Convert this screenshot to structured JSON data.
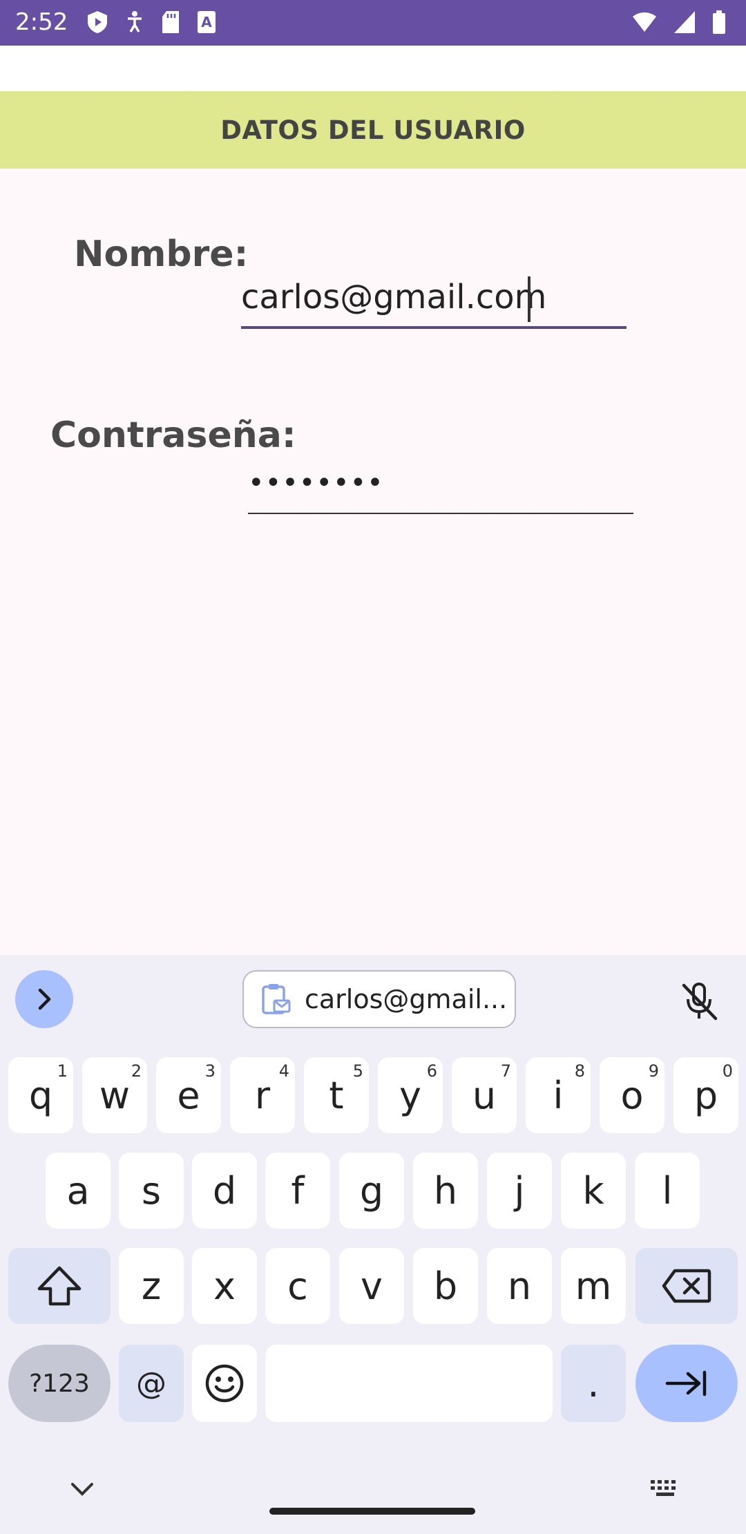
{
  "status_bar": {
    "time": "2:52",
    "icons_left": [
      "shield-play-icon",
      "accessibility-icon",
      "sd-card-icon",
      "font-a-icon"
    ],
    "icons_right": [
      "wifi-icon",
      "signal-icon",
      "battery-icon"
    ],
    "color": "#6750A4"
  },
  "header": {
    "title": "DATOS DEL USUARIO",
    "color": "#E0E88F"
  },
  "form": {
    "name_label": "Nombre:",
    "name_value": "carlos@gmail.com",
    "password_label": "Contraseña:",
    "password_value": "••••••••"
  },
  "keyboard": {
    "clipboard_suggestion": "carlos@gmail...",
    "row1": [
      {
        "k": "q",
        "h": "1"
      },
      {
        "k": "w",
        "h": "2"
      },
      {
        "k": "e",
        "h": "3"
      },
      {
        "k": "r",
        "h": "4"
      },
      {
        "k": "t",
        "h": "5"
      },
      {
        "k": "y",
        "h": "6"
      },
      {
        "k": "u",
        "h": "7"
      },
      {
        "k": "i",
        "h": "8"
      },
      {
        "k": "o",
        "h": "9"
      },
      {
        "k": "p",
        "h": "0"
      }
    ],
    "row2": [
      "a",
      "s",
      "d",
      "f",
      "g",
      "h",
      "j",
      "k",
      "l"
    ],
    "row3": [
      "z",
      "x",
      "c",
      "v",
      "b",
      "n",
      "m"
    ],
    "symbols_label": "?123",
    "at_label": "@",
    "period_label": ".",
    "space_label": ""
  }
}
